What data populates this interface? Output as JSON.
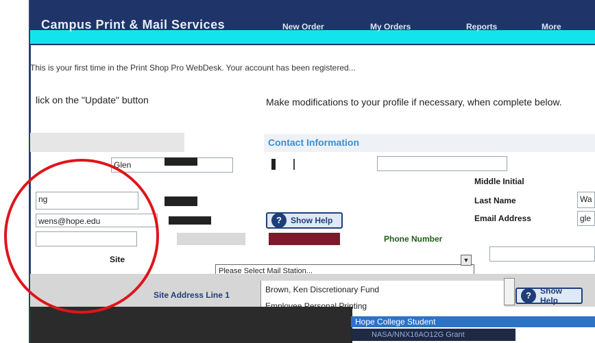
{
  "nav": {
    "title": "Campus Print & Mail Services",
    "links": [
      "New Order",
      "My Orders",
      "Reports",
      "More"
    ]
  },
  "info_line": "This is your first time in the Print Shop Pro WebDesk. Your account has been registered...",
  "instructions": {
    "left": "lick on the \"Update\" button",
    "right": "Make modifications to your profile if necessary, when complete below."
  },
  "contact_header": "Contact Information",
  "labels": {
    "middle_initial": "Middle Initial",
    "last_name": "Last Name",
    "email_address": "Email Address",
    "phone_number": "Phone Number",
    "site": "Site",
    "site_address_line1": "Site Address Line 1"
  },
  "fields": {
    "first_name_value": "Glen",
    "last_name_left_value": "ng",
    "email_left_value": "wens@hope.edu",
    "last_name_right_value": "Wa",
    "email_right_value": "gle"
  },
  "help_button_label": "Show Help",
  "dropdown_value": "Please Select Mail Station...",
  "list": {
    "items": [
      "Brown, Ken Discretionary Fund",
      "Employee Personal Printing",
      "Hope College Student",
      "NASA/NNX16AO12G Grant"
    ],
    "selected_index": 2
  },
  "colors": {
    "nav_bg": "#1f3468",
    "accent_cyan": "#13e4ec",
    "annotation_red": "#e0141a",
    "selected_blue": "#2d72c7"
  }
}
